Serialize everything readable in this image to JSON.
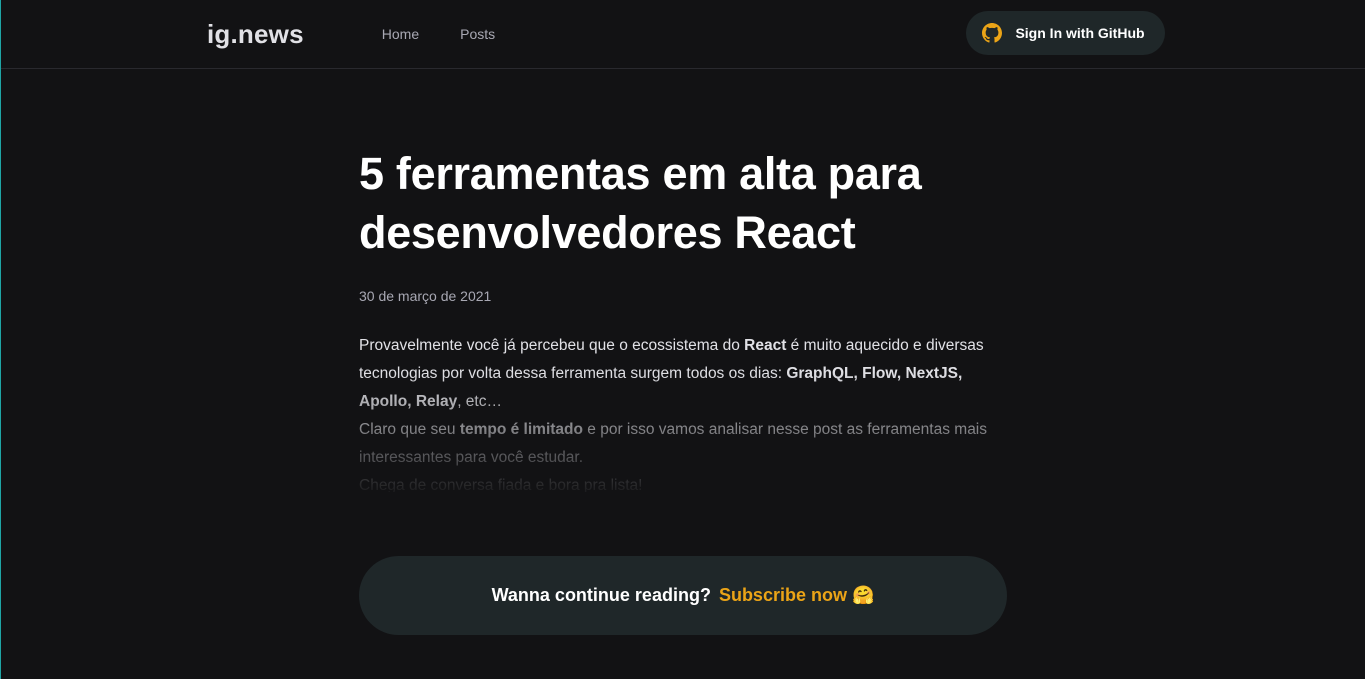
{
  "header": {
    "logo": "ig.news",
    "nav": [
      "Home",
      "Posts"
    ],
    "signin_label": "Sign In with GitHub"
  },
  "article": {
    "title": "5 ferramentas em alta para desenvolvedores React",
    "date": "30 de março de 2021",
    "paragraphs": [
      [
        {
          "text": "Provavelmente você já percebeu que o ecossistema do ",
          "bold": false
        },
        {
          "text": "React",
          "bold": true
        },
        {
          "text": " é muito aquecido e diversas tecnologias por volta dessa ferramenta surgem todos os dias: ",
          "bold": false
        },
        {
          "text": "GraphQL, Flow, NextJS, Apollo, Relay",
          "bold": true
        },
        {
          "text": ", etc…",
          "bold": false
        }
      ],
      [
        {
          "text": "Claro que seu ",
          "bold": false
        },
        {
          "text": "tempo é limitado",
          "bold": true
        },
        {
          "text": " e por isso vamos analisar nesse post as ferramentas mais interessantes para você estudar.",
          "bold": false
        }
      ],
      [
        {
          "text": "Chega de conversa fiada e bora pra lista!",
          "bold": false
        }
      ]
    ]
  },
  "continue_reading": {
    "prompt": "Wanna continue reading?",
    "link": "Subscribe now",
    "emoji": "🤗"
  },
  "colors": {
    "background": "#121214",
    "card": "#1f2729",
    "accent": "#eba417",
    "muted": "#a8a8b3"
  },
  "icons": {
    "signin": "github-icon"
  }
}
